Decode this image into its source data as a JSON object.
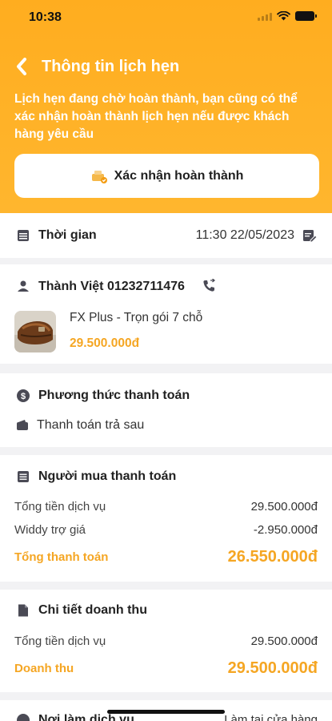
{
  "status": {
    "time": "10:38"
  },
  "nav": {
    "title": "Thông tin lịch hẹn"
  },
  "banner": {
    "message": "Lịch hẹn đang chờ hoàn thành, bạn cũng có thể xác nhận hoàn thành lịch hẹn nếu được khách hàng yêu cầu"
  },
  "confirm_button": {
    "label": "Xác nhận hoàn thành"
  },
  "time_section": {
    "label": "Thời gian",
    "value": "11:30 22/05/2023"
  },
  "customer": {
    "name_phone": "Thành Việt 01232711476",
    "product_name": "FX Plus - Trọn gói 7 chỗ",
    "product_price": "29.500.000đ"
  },
  "payment_method": {
    "title": "Phương thức thanh toán",
    "value": "Thanh toán trả sau"
  },
  "buyer_payment": {
    "title": "Người mua thanh toán",
    "rows": [
      {
        "label": "Tổng tiền dịch vụ",
        "value": "29.500.000đ"
      },
      {
        "label": "Widdy trợ giá",
        "value": "-2.950.000đ"
      }
    ],
    "total_label": "Tổng thanh toán",
    "total_value": "26.550.000đ"
  },
  "revenue": {
    "title": "Chi tiết doanh thu",
    "rows": [
      {
        "label": "Tổng tiền dịch vụ",
        "value": "29.500.000đ"
      }
    ],
    "total_label": "Doanh thu",
    "total_value": "29.500.000đ"
  },
  "service_place": {
    "title": "Nơi làm dịch vụ",
    "value": "Làm tại cửa hàng"
  },
  "colors": {
    "accent": "#ffad1f",
    "price": "#f5a623",
    "background": "#f2f2f4"
  }
}
